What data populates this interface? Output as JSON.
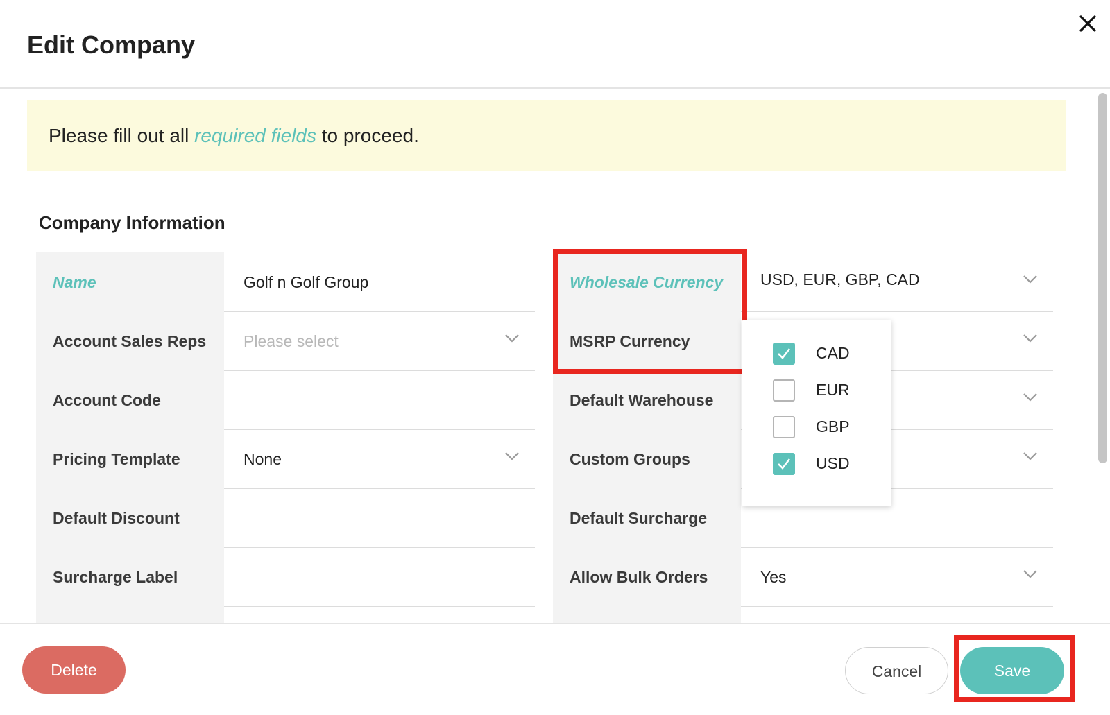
{
  "header": {
    "title": "Edit Company",
    "close_icon": "close-icon"
  },
  "notice": {
    "prefix": "Please fill out all ",
    "link": "required fields",
    "suffix": " to proceed."
  },
  "section": {
    "title": "Company Information"
  },
  "left_fields": [
    {
      "label": "Name",
      "value": "Golf n Golf Group",
      "required": true
    },
    {
      "label": "Account Sales Reps",
      "placeholder": "Please select",
      "dropdown": true
    },
    {
      "label": "Account Code",
      "value": ""
    },
    {
      "label": "Pricing Template",
      "value": "None",
      "dropdown": true
    },
    {
      "label": "Default Discount",
      "value": ""
    },
    {
      "label": "Surcharge Label",
      "value": ""
    }
  ],
  "right_fields": [
    {
      "label": "Wholesale Currency",
      "value": "USD, EUR, GBP, CAD",
      "required": true,
      "dropdown": true
    },
    {
      "label": "MSRP Currency",
      "value": "",
      "dropdown": true
    },
    {
      "label": "Default Warehouse",
      "value": "",
      "dropdown": true
    },
    {
      "label": "Custom Groups",
      "value": "",
      "dropdown": true
    },
    {
      "label": "Default Surcharge",
      "value": ""
    },
    {
      "label": "Allow Bulk Orders",
      "value": "Yes",
      "dropdown": true
    }
  ],
  "currency_dropdown": {
    "options": [
      {
        "label": "CAD",
        "checked": true
      },
      {
        "label": "EUR",
        "checked": false
      },
      {
        "label": "GBP",
        "checked": false
      },
      {
        "label": "USD",
        "checked": true
      }
    ]
  },
  "footer": {
    "delete_label": "Delete",
    "cancel_label": "Cancel",
    "save_label": "Save"
  },
  "colors": {
    "accent": "#5cc1b9",
    "danger": "#db6b62",
    "highlight": "#e8261f",
    "notice_bg": "#fcfadd"
  }
}
